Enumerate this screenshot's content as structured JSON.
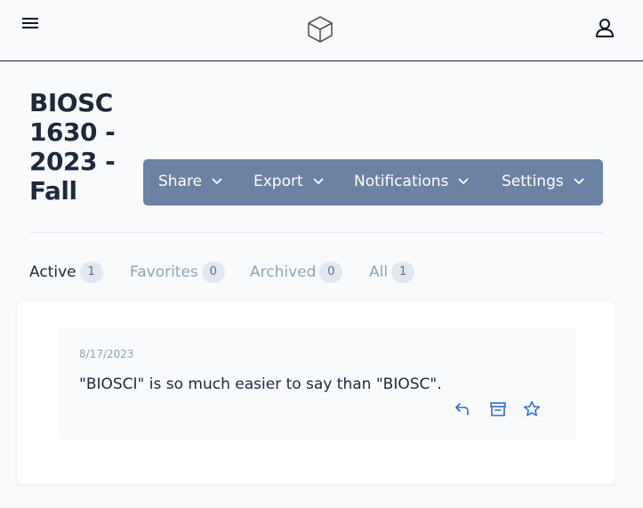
{
  "header": {
    "menu_icon": "hamburger-menu-icon",
    "logo_icon": "cube-logo-icon",
    "user_icon": "user-icon"
  },
  "page": {
    "title": "BIOSC 1630 - 2023 - Fall"
  },
  "toolbar": {
    "items": [
      {
        "label": "Share"
      },
      {
        "label": "Export"
      },
      {
        "label": "Notifications"
      },
      {
        "label": "Settings"
      }
    ],
    "background": "#6b82a5"
  },
  "tabs": [
    {
      "label": "Active",
      "count": "1",
      "active": true
    },
    {
      "label": "Favorites",
      "count": "0",
      "active": false
    },
    {
      "label": "Archived",
      "count": "0",
      "active": false
    },
    {
      "label": "All",
      "count": "1",
      "active": false
    }
  ],
  "notes": [
    {
      "date": "8/17/2023",
      "text": "\"BIOSCI\" is so much easier to say than \"BIOSC\".",
      "actions": [
        "reply-icon",
        "archive-icon",
        "star-icon"
      ]
    }
  ],
  "colors": {
    "accent": "#2b6cd4",
    "text": "#1e293b",
    "muted": "#94a3b8"
  }
}
